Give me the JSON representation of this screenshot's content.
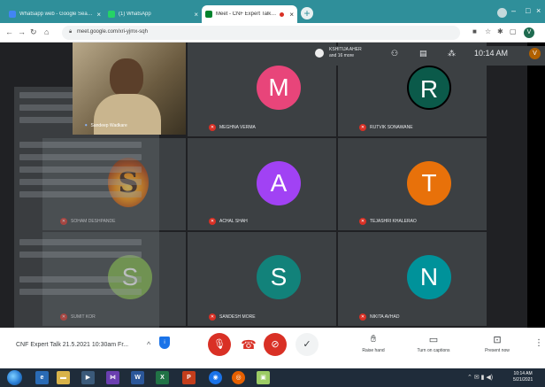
{
  "browser": {
    "tabs": [
      {
        "title": "Whatsapp web - Google Search",
        "favicon_color": "#4285f4"
      },
      {
        "title": "(1) WhatsApp",
        "favicon_color": "#25d366"
      },
      {
        "title": "Meet - CNF Expert Talk 21.5",
        "favicon_color": "#00832d"
      }
    ],
    "address": "meet.google.com/xri-yjmx-sqh"
  },
  "meet": {
    "participants_label": "KSHITIJA AHER",
    "participants_more": "and 16 more",
    "time": "10:14 AM",
    "self_initial": "V",
    "tiles": [
      {
        "name": "MEGHNA VERMA",
        "initial": "M",
        "color": "#e8457a"
      },
      {
        "name": "RUTVIK SONAWANE",
        "initial": "R",
        "color": "#0b5a4a"
      },
      {
        "name": "SOHAM DESHPANDE",
        "initial": "S",
        "color": "#b33a00"
      },
      {
        "name": "ACHAL SHAH",
        "initial": "A",
        "color": "#a142f4"
      },
      {
        "name": "TEJASHRI KHALERAO",
        "initial": "T",
        "color": "#e8710a"
      },
      {
        "name": "SUMIT KOR",
        "initial": "S",
        "color": "#7cb342"
      },
      {
        "name": "SANDESH MORE",
        "initial": "S",
        "color": "#12827a"
      },
      {
        "name": "NIKITA AVHAD",
        "initial": "N",
        "color": "#00929a"
      }
    ],
    "camera_name": "Sandeep Wadkare"
  },
  "controls": {
    "meeting_title": "CNF Expert Talk 21.5.2021 10:30am Fr...",
    "raise_hand": "Raise hand",
    "captions": "Turn on captions",
    "present": "Present now"
  },
  "taskbar": {
    "clock_time": "10:14 AM",
    "clock_date": "5/21/2021"
  }
}
